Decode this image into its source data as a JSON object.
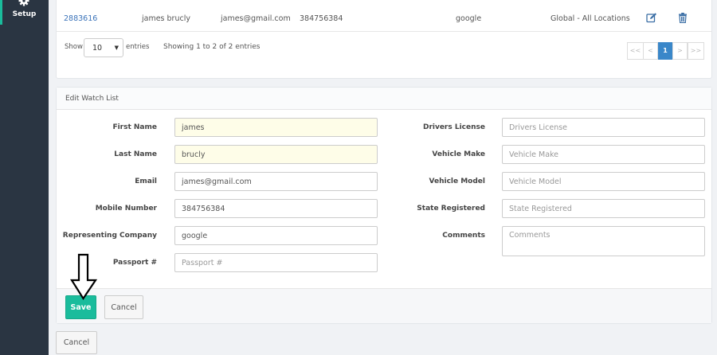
{
  "sidebar": {
    "setup_label": "Setup"
  },
  "table": {
    "row": {
      "id": "2883616",
      "name": "james brucly",
      "email": "james@gmail.com",
      "phone": "384756384",
      "company": "google",
      "location": "Global - All Locations"
    },
    "show_label": "Show",
    "entries_value": "10",
    "entries_label": "entries",
    "showing_text": "Showing 1 to 2 of 2 entries",
    "pagination": {
      "first": "<<",
      "prev": "<",
      "current": "1",
      "next": ">",
      "last": ">>"
    }
  },
  "form": {
    "title": "Edit Watch List",
    "first_name": {
      "label": "First Name",
      "value": "james"
    },
    "last_name": {
      "label": "Last Name",
      "value": "brucly"
    },
    "email": {
      "label": "Email",
      "value": "james@gmail.com"
    },
    "mobile": {
      "label": "Mobile Number",
      "value": "384756384"
    },
    "company": {
      "label": "Representing Company",
      "value": "google"
    },
    "passport": {
      "label": "Passport #",
      "placeholder": "Passport #"
    },
    "drivers_license": {
      "label": "Drivers License",
      "placeholder": "Drivers License"
    },
    "vehicle_make": {
      "label": "Vehicle Make",
      "placeholder": "Vehicle Make"
    },
    "vehicle_model": {
      "label": "Vehicle Model",
      "placeholder": "Vehicle Model"
    },
    "state_registered": {
      "label": "State Registered",
      "placeholder": "State Registered"
    },
    "comments": {
      "label": "Comments",
      "placeholder": "Comments"
    },
    "save_label": "Save",
    "cancel_label": "Cancel"
  },
  "page": {
    "cancel_label": "Cancel"
  },
  "colors": {
    "accent": "#1abc9c",
    "sidebar": "#2a3542",
    "link": "#3b73b9",
    "page_active": "#3a87c9"
  }
}
